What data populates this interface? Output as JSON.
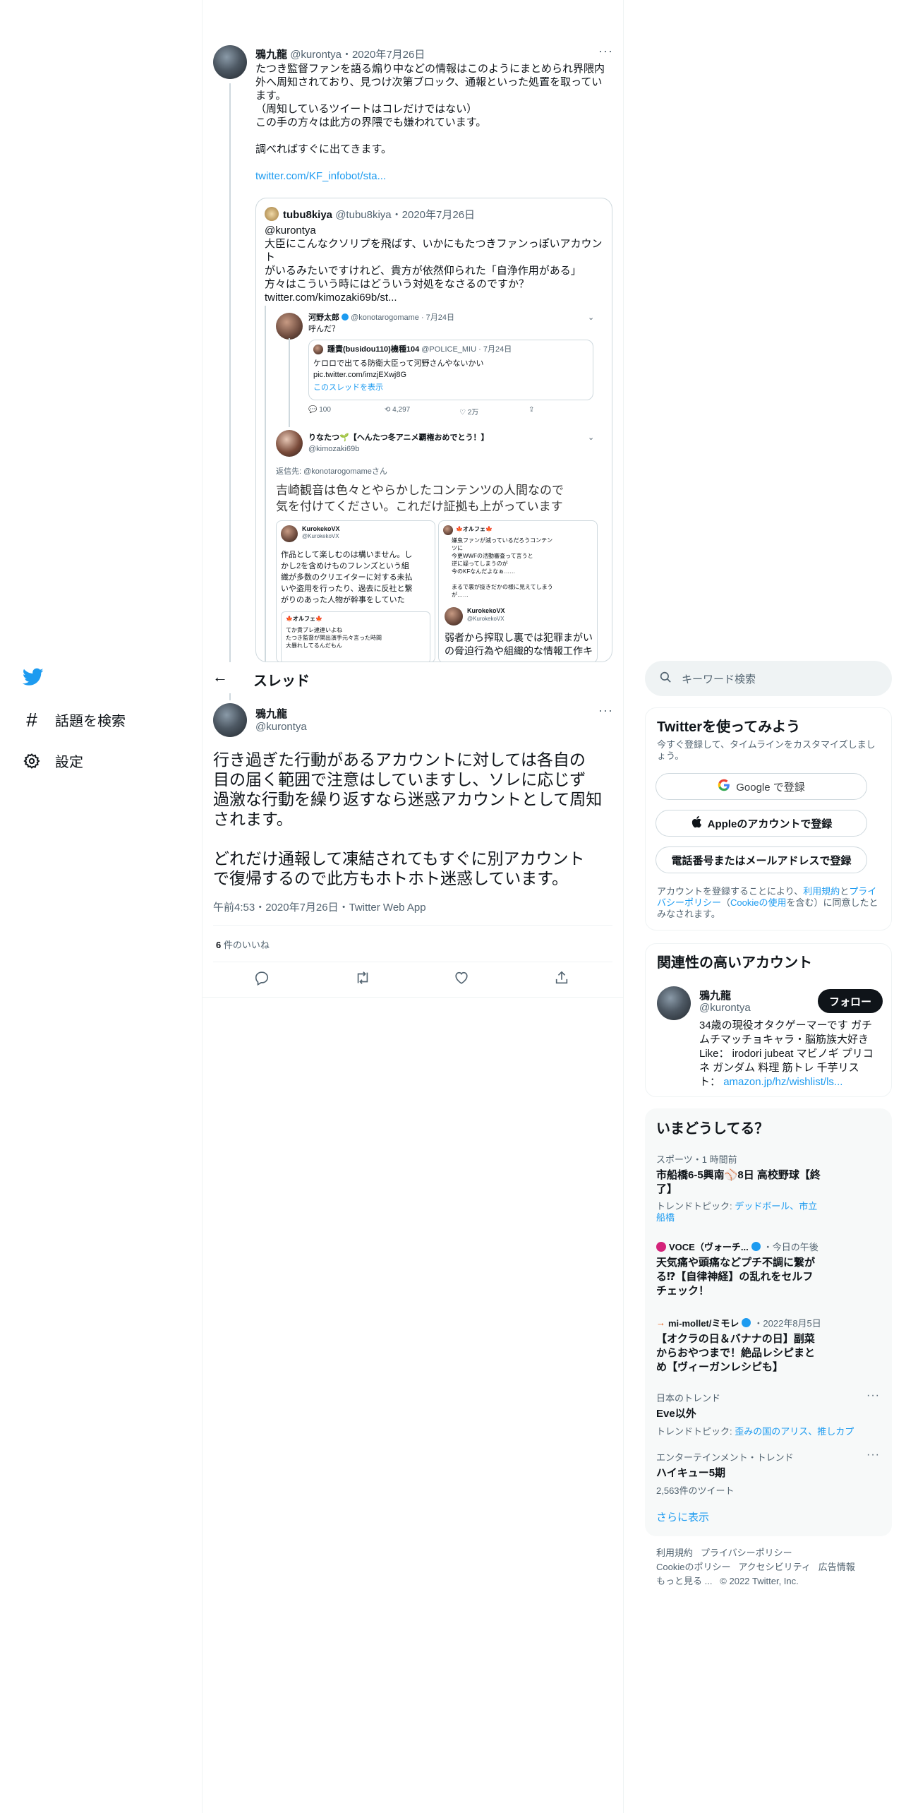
{
  "parent_tweet": {
    "name": "鴉九龍",
    "handle": "@kurontya",
    "date": "・2020年7月26日",
    "text_lines": [
      "たつき監督ファンを語る煽り中などの情報はこのようにまとめられ界隈内",
      "外へ周知されており、見つけ次第ブロック、通報といった処置を取ってい",
      "ます。",
      "（周知しているツイートはコレだけではない）",
      "この手の方々は此方の界隈でも嫌われています。",
      "",
      "調べればすぐに出てきます。"
    ],
    "link": "twitter.com/KF_infobot/sta...",
    "quote": {
      "name": "tubu8kiya",
      "handle": "@tubu8kiya",
      "date": "・2020年7月26日",
      "text_lines": [
        "@kurontya",
        "大臣にこんなクソリプを飛ばす、いかにもたつきファンっぽいアカウント",
        "がいるみたいですけれど、貴方が依然仰られた「自浄作用がある」",
        "方々はこういう時にはどういう対処をなさるのですか？",
        "twitter.com/kimozaki69b/st..."
      ],
      "shot": {
        "t1_name": "河野太郎",
        "t1_handle": "@konotarogomame · 7月24日",
        "t1_text": "呼んだ？",
        "t1_inner_name": "踵責(busidou110)機種104",
        "t1_inner_handle": "@POLICE_MIU · 7月24日",
        "t1_inner_text1": "ケロロで出てる防衛大臣って河野さんやないかい",
        "t1_inner_text2": "pic.twitter.com/imzjEXwj8G",
        "t1_inner_thread": "このスレッドを表示",
        "t1_stats": [
          "100",
          "4,297",
          "2万",
          ""
        ],
        "t2_name": "りなたつ🌱【へんたつ冬アニメ覇権おめでとう！】",
        "t2_handle": "@kimozaki69b",
        "t2_reply": "返信先: @konotarogomameさん",
        "t2_text1": "吉崎観音は色々とやらかしたコンテンツの人間なので",
        "t2_text2": "気を付けてください。これだけ証拠も上がっています",
        "c1_name": "KurokekoVX",
        "c1_handle": "@KurokekoVX",
        "c1_lines": [
          "作品として楽しむのは構いません。し",
          "かし2を含めけものフレンズという組",
          "織が多数のクリエイターに対する未払",
          "いや盗用を行ったり、過去に反社と繋",
          "がりのあった人物が幹事をしていた"
        ],
        "c1_sub_name": "🍁オルフェ🍁",
        "c1_sub_lines": [
          "てか貴ブレ逮連いよね",
          "たつき監督が関出演手元々言った時間",
          "大暴れしてるんだもん"
        ],
        "c2_name": "🍁オルフェ🍁",
        "c2_lines": [
          "嫌虫ファンが減っているだろうコンテン",
          "ツに",
          "今更WWFの活動審査って言うと",
          "逆に疑ってしまうのが",
          "今のKFなんだよなぁ……",
          "",
          "まるで裏が抜きだかの様に見えてしまう",
          "が……"
        ],
        "c2_sub_name": "KurokekoVX",
        "c2_sub_handle": "@KurokekoVX",
        "c2_big1": "弱者から搾取し裏では犯罪まがい",
        "c2_big2": "の脅迫行為や組織的な情報工作キ"
      }
    }
  },
  "header": {
    "back_label": "←",
    "title": "スレッド"
  },
  "nav": {
    "explore_label": "話題を検索",
    "settings_label": "設定"
  },
  "main_tweet": {
    "name": "鴉九龍",
    "handle": "@kurontya",
    "text_lines": [
      "行き過ぎた行動があるアカウントに対しては各自の",
      "目の届く範囲で注意はしていますし、ソレに応じず",
      "過激な行動を繰り返すなら迷惑アカウントとして周知",
      "されます。",
      "",
      "どれだけ通報して凍結されてもすぐに別アカウント",
      "で復帰するので此方もホトホト迷惑しています。"
    ],
    "timestamp": "午前4:53・2020年7月26日・Twitter Web App",
    "likes_count": "6",
    "likes_label": " 件のいいね"
  },
  "search": {
    "placeholder": "キーワード検索"
  },
  "signup": {
    "title": "Twitterを使ってみよう",
    "subtitle": "今すぐ登録して、タイムラインをカスタマイズしましょう。",
    "google_label": "Google で登録",
    "apple_label": "Appleのアカウントで登録",
    "phone_label": "電話番号またはメールアドレスで登録",
    "legal_1": "アカウントを登録することにより、",
    "legal_terms": "利用規約",
    "legal_and": "と",
    "legal_privacy": "プライバシーポリシー",
    "legal_2": "（",
    "legal_cookie": "Cookieの使用",
    "legal_3": "を含む）に同意したとみなされます。"
  },
  "related": {
    "title": "関連性の高いアカウント",
    "name": "鴉九龍",
    "handle": "@kurontya",
    "follow_label": "フォロー",
    "bio_lines": [
      "34歳の現役オタクゲーマーです ガチ",
      "ムチマッチョキャラ・脳筋族大好き",
      "Like： irodori jubeat マビノギ プリコ",
      "ネ ガンダム 料理 筋トレ 千芋リス"
    ],
    "bio_last_prefix": "ト：",
    "bio_link": "amazon.jp/hz/wishlist/ls..."
  },
  "trends": {
    "title": "いまどうしてる？",
    "items": [
      {
        "meta": "スポーツ・1 時間前",
        "title_line1": "市船橋6-5興南⚾8日 高校野球【終",
        "title_line2": "了】",
        "topic_prefix": "トレンドトピック: ",
        "topic_line1": "デッドボール、市立",
        "topic_line2": "船橋"
      },
      {
        "meta_name": "VOCE（ヴォーチ...",
        "meta_time": "・今日の午後",
        "title_lines": [
          "天気痛や頭痛などプチ不調に繋が",
          "る⁉【自律神経】の乱れをセルフ",
          "チェック！"
        ]
      },
      {
        "meta_name": "mi-mollet/ミモレ",
        "meta_time": "・2022年8月5日",
        "title_lines": [
          "【オクラの日＆バナナの日】副菜",
          "からおやつまで！絶品レシピまと",
          "め【ヴィーガンレシピも】"
        ]
      },
      {
        "meta": "日本のトレンド",
        "title": "Eve以外",
        "topic_prefix": "トレンドトピック: ",
        "topic": "歪みの国のアリス、推しカプ"
      },
      {
        "meta": "エンターテインメント・トレンド",
        "title": "ハイキュー5期",
        "count": "2,563件のツイート"
      }
    ],
    "show_more": "さらに表示"
  },
  "footer": {
    "line1": [
      "利用規約",
      "プライバシーポリシー"
    ],
    "line2": [
      "Cookieのポリシー",
      "アクセシビリティ",
      "広告情報"
    ],
    "more": "もっと見る ...",
    "copyright": "© 2022 Twitter, Inc."
  },
  "colors": {
    "accent": "#1d9bf0",
    "text": "#0f1419",
    "muted": "#536471",
    "border": "#eff3f4"
  }
}
